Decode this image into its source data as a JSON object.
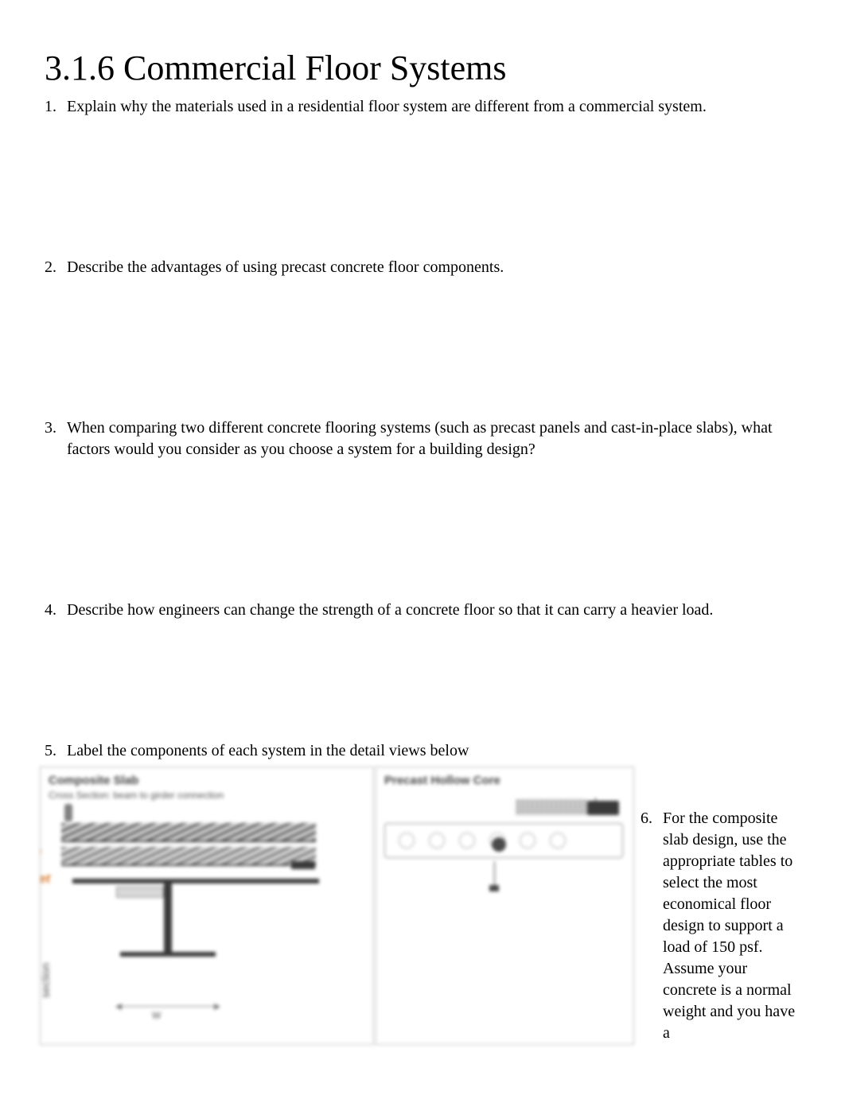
{
  "title": "3.1.6 Commercial Floor Systems",
  "questions": {
    "q1": {
      "num": "1.",
      "text": "Explain why the materials used in a residential floor system are different from a commercial system."
    },
    "q2": {
      "num": "2.",
      "text": "Describe the advantages of using precast concrete floor components."
    },
    "q3": {
      "num": "3.",
      "text": "When comparing two different concrete flooring systems (such as precast panels and cast-in-place slabs), what factors would you consider as you choose a system for a building design?"
    },
    "q4": {
      "num": "4.",
      "text": "Describe how engineers can change the strength of a concrete floor so that it can carry a heavier load."
    },
    "q5": {
      "num": "5.",
      "text": "Label the components of each system in the detail views below"
    },
    "q6": {
      "num": "6.",
      "text": "For the composite slab design, use the appropriate tables to select the most economical floor design to support a load of 150 psf. Assume your concrete is a normal weight and you have a"
    }
  },
  "diagram_left": {
    "title": "Composite Slab",
    "subtitle": "Cross Section: beam to girder connection"
  },
  "diagram_right": {
    "title": "Precast Hollow Core"
  }
}
